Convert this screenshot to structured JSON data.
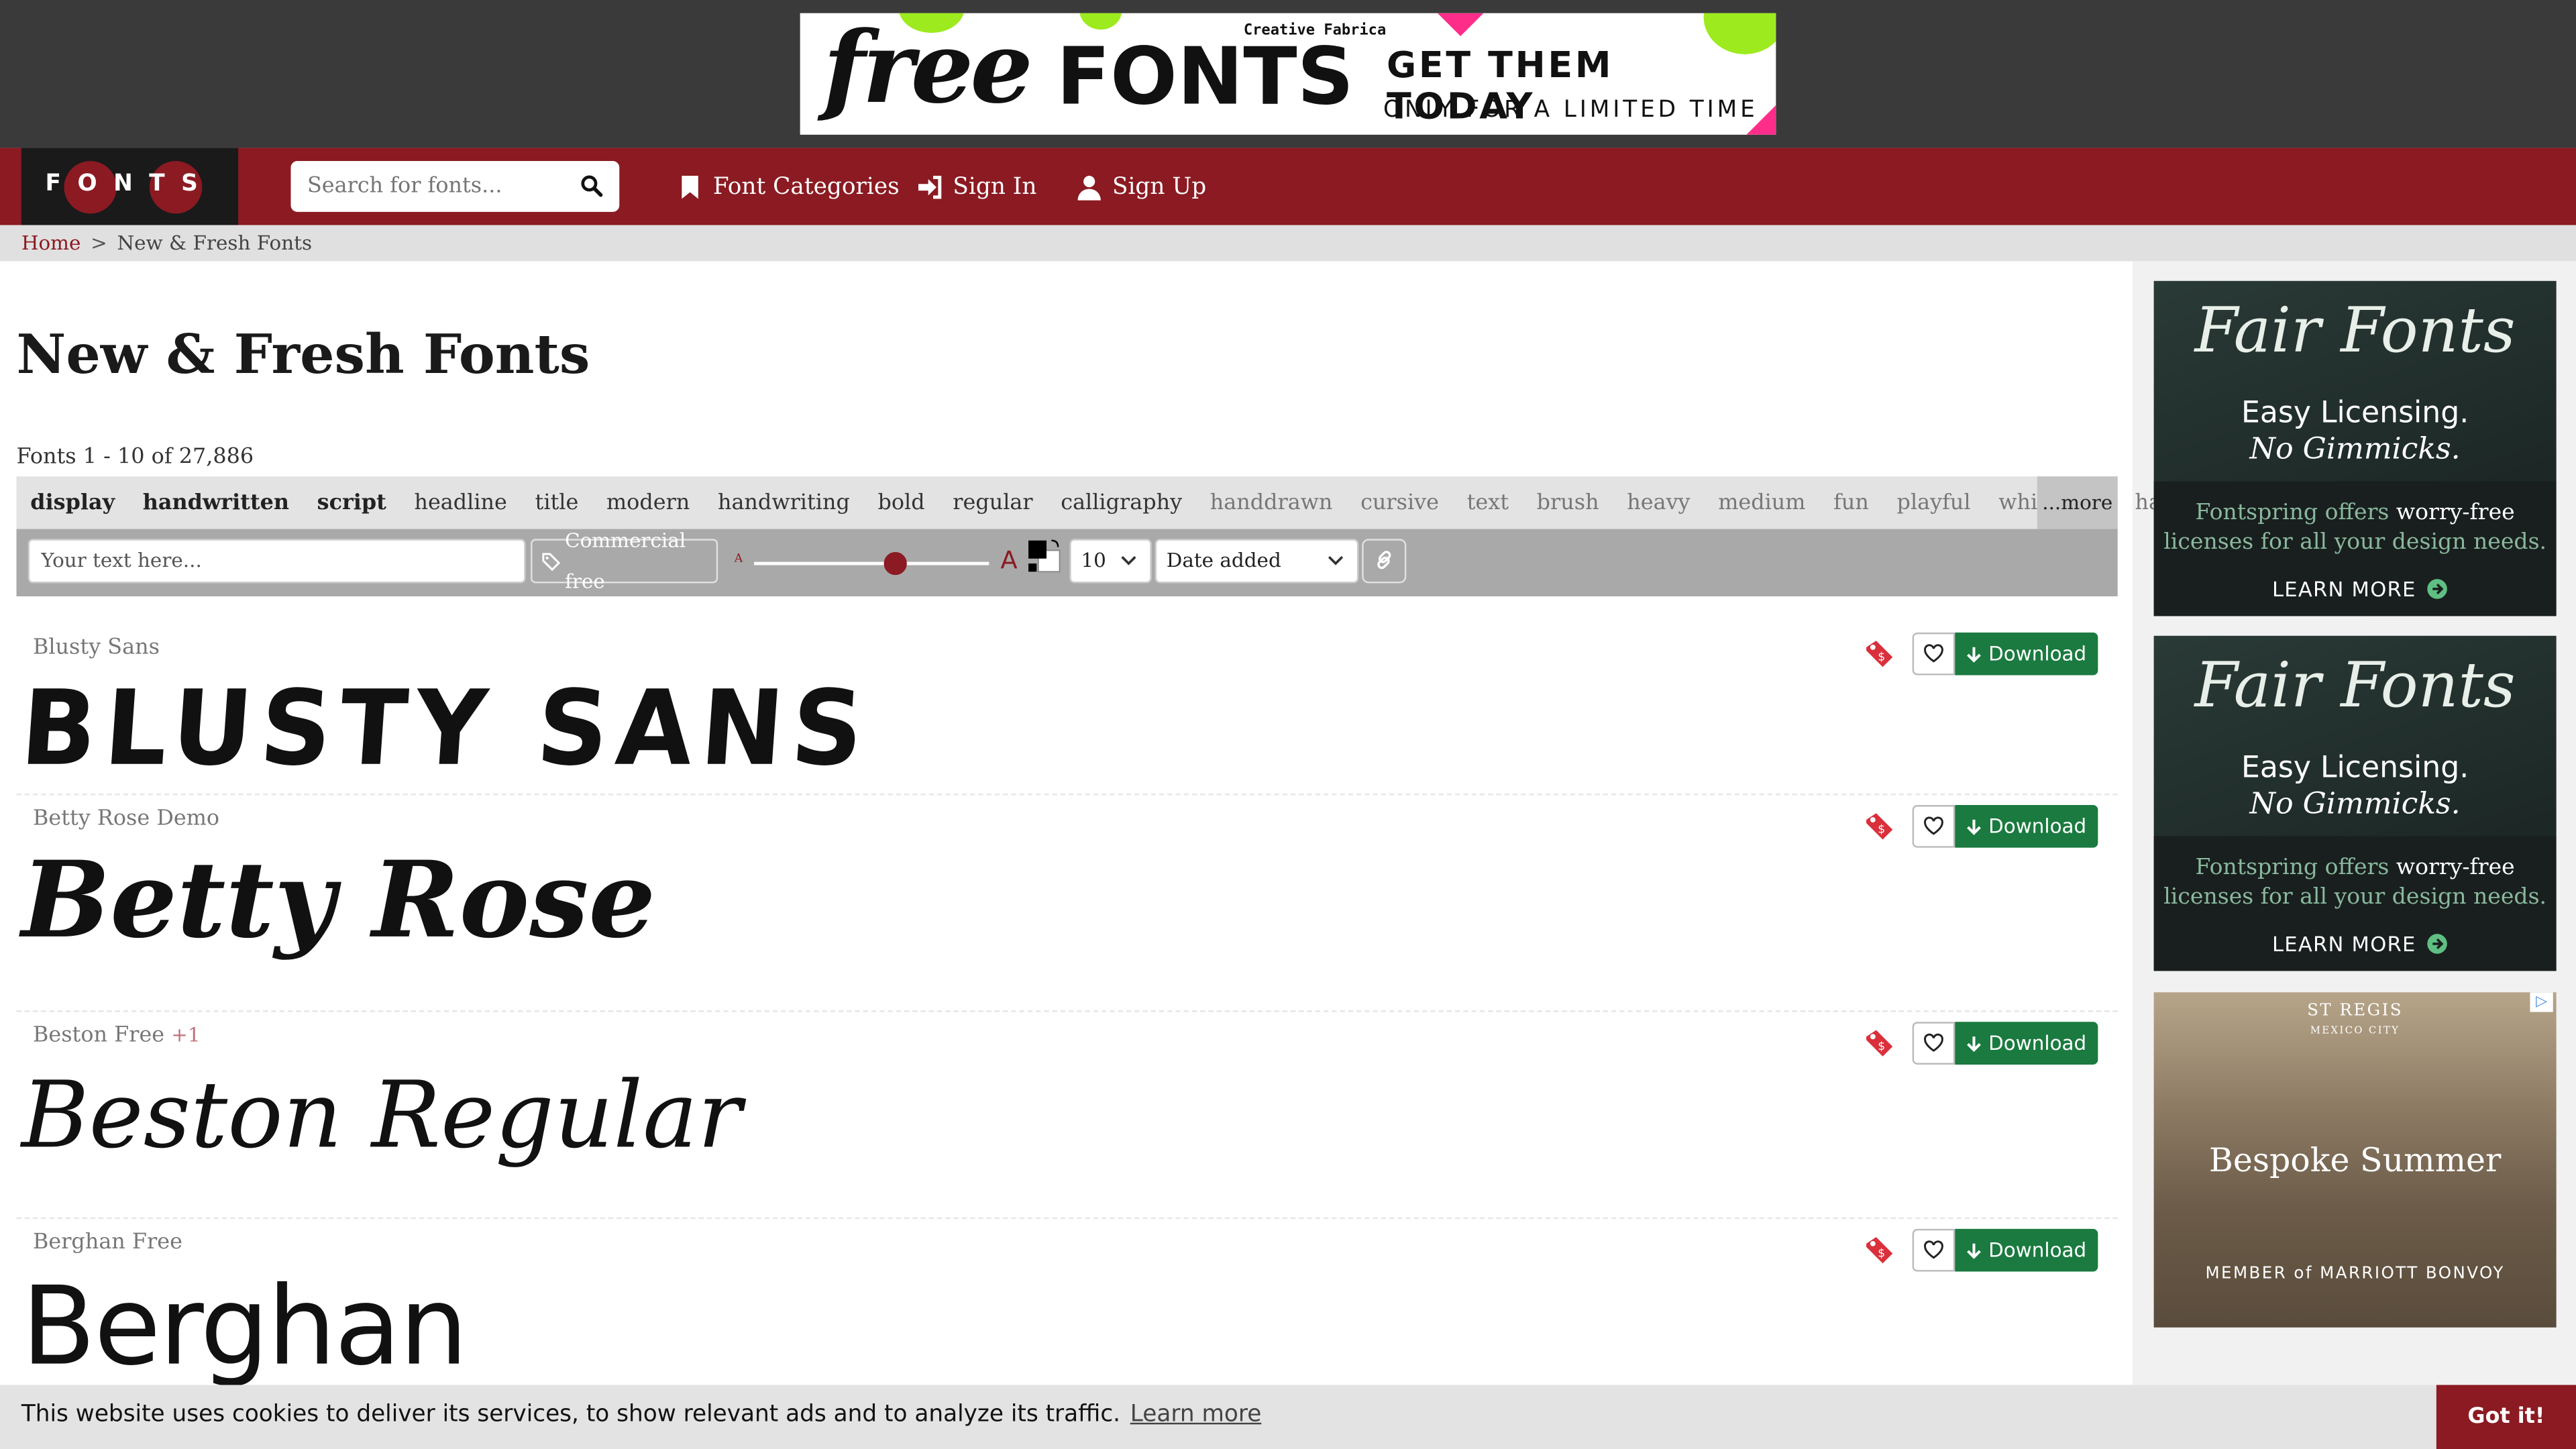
{
  "top_ad": {
    "word1": "free",
    "word2": "FONTS",
    "brand": "Creative Fabrica",
    "headline": "GET THEM TODAY",
    "subline": "ONLY FOR A LIMITED TIME"
  },
  "header": {
    "logo_text": "FONTS",
    "search_placeholder": "Search for fonts...",
    "nav": [
      {
        "label": "Font Categories",
        "icon": "bookmark-icon"
      },
      {
        "label": "Sign In",
        "icon": "sign-in-icon"
      },
      {
        "label": "Sign Up",
        "icon": "user-icon"
      }
    ]
  },
  "breadcrumb": {
    "home": "Home",
    "separator": ">",
    "current": "New & Fresh Fonts"
  },
  "main": {
    "title": "New & Fresh Fonts",
    "count": "Fonts 1 - 10 of 27,886",
    "tags_bold": [
      "display",
      "handwritten",
      "script"
    ],
    "tags_medium": [
      "headline",
      "title",
      "modern",
      "handwriting",
      "bold",
      "regular",
      "calligraphy"
    ],
    "tags_light": [
      "handdrawn",
      "cursive",
      "text",
      "brush",
      "heavy",
      "medium",
      "fun",
      "playful",
      "whimsical",
      "handlettering"
    ],
    "more": "...more"
  },
  "toolbar": {
    "text_placeholder": "Your text here...",
    "commercial_label": "Commercial free",
    "size_small": "A",
    "size_large": "A",
    "size_value": 0.6,
    "per_page": "10",
    "sort": "Date added"
  },
  "fonts": [
    {
      "name": "Blusty Sans",
      "extra": "",
      "preview": "BLUSTY SANS",
      "download": "Download"
    },
    {
      "name": "Betty Rose Demo",
      "extra": "",
      "preview": "Betty Rose",
      "download": "Download"
    },
    {
      "name": "Beston Free",
      "extra": "+1",
      "preview": "Beston Regular",
      "download": "Download"
    },
    {
      "name": "Berghan Free",
      "extra": "",
      "preview": "Berghan",
      "download": "Download"
    }
  ],
  "sidebar_ads": [
    {
      "logo": "Fair Fonts",
      "line1": "Easy Licensing.",
      "line2": "No Gimmicks.",
      "line3a": "Fontspring offers",
      "line3b": "worry-free",
      "line4": "licenses for all your design needs.",
      "cta": "LEARN MORE"
    },
    {
      "logo": "Fair Fonts",
      "line1": "Easy Licensing.",
      "line2": "No Gimmicks.",
      "line3a": "Fontspring offers",
      "line3b": "worry-free",
      "line4": "licenses for all your design needs.",
      "cta": "LEARN MORE"
    }
  ],
  "stregis_ad": {
    "brand": "ST REGIS",
    "city": "MEXICO CITY",
    "title": "Bespoke Summer",
    "member": "MEMBER of MARRIOTT BONVOY"
  },
  "cookie": {
    "message": "This website uses cookies to deliver its services, to show relevant ads and to analyze its traffic.",
    "learn_more": "Learn more",
    "accept": "Got it!"
  },
  "colors": {
    "brand": "#8b1a22",
    "download": "#1a7a3f"
  }
}
